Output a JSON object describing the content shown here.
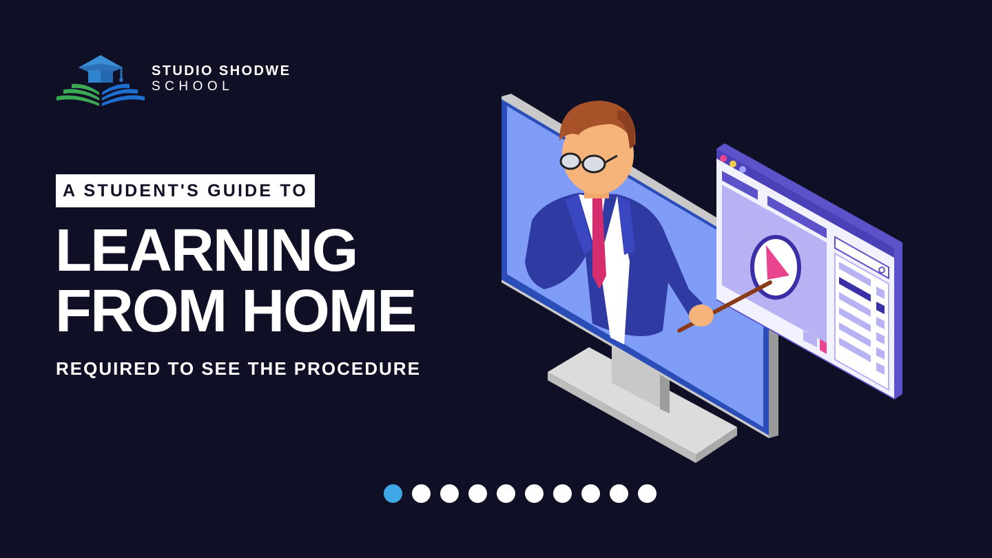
{
  "brand": {
    "name": "STUDIO SHODWE",
    "sub": "SCHOOL"
  },
  "hero": {
    "tagline": "A STUDENT'S GUIDE TO",
    "title_line1": "LEARNING",
    "title_line2": "FROM HOME",
    "subtitle": "REQUIRED TO SEE THE PROCEDURE"
  },
  "pager": {
    "count": 10,
    "active_index": 0
  },
  "colors": {
    "background": "#0f1026",
    "accent": "#3ea7e6",
    "screen": "#7f9df7",
    "panel": "#b7b2f4",
    "panel_frame": "#5c52c9",
    "play": "#e8458e",
    "suit": "#2f3aa3",
    "tie": "#d62d6f",
    "hair": "#a8522a",
    "skin": "#f6b47b"
  },
  "icons": {
    "logo": "graduation-cap-book-icon",
    "play": "play-icon",
    "search": "search-icon"
  }
}
